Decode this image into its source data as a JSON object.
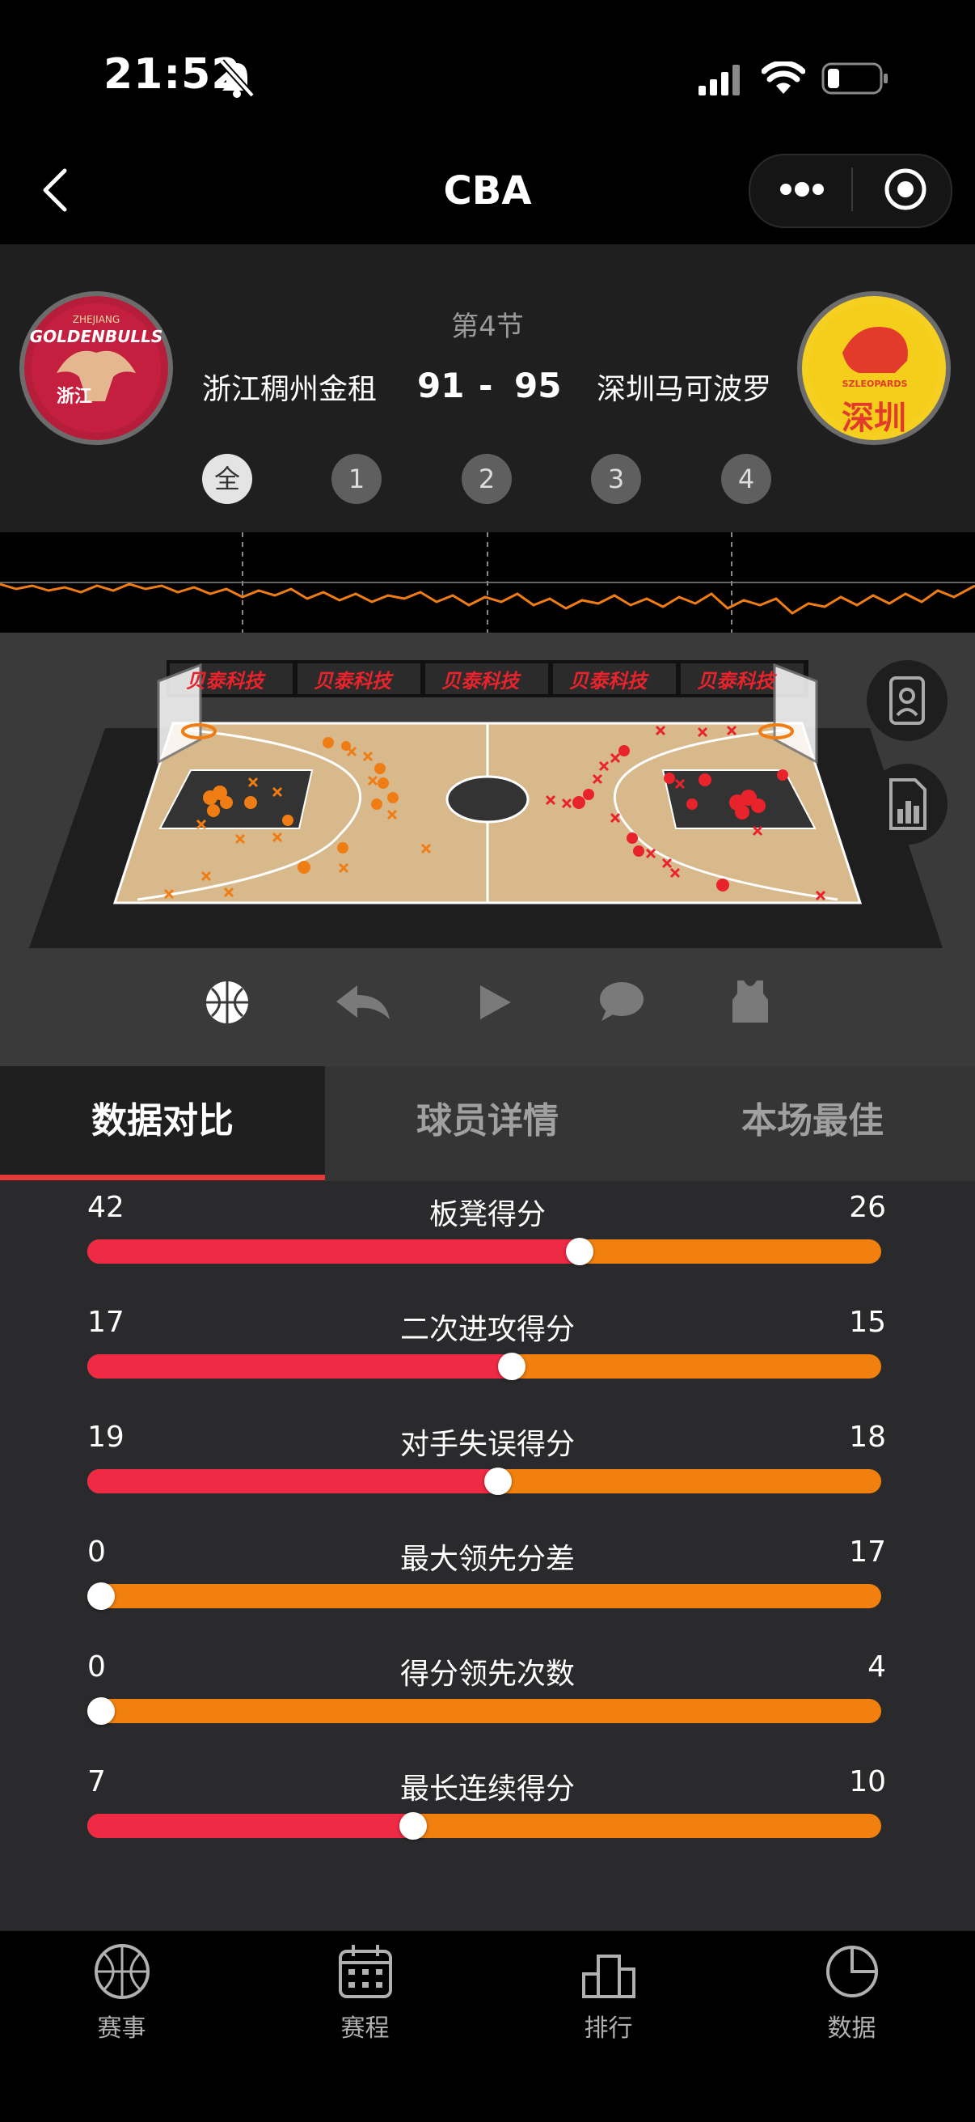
{
  "status": {
    "time": "21:52"
  },
  "nav": {
    "title": "CBA"
  },
  "match": {
    "period": "第4节",
    "home": {
      "name": "浙江稠州金租",
      "score": "91",
      "logo_text_top": "GOLDENBULLS",
      "logo_text_sub": "浙江",
      "logo_text_tiny": "ZHEJIANG"
    },
    "away": {
      "name": "深圳马可波罗",
      "score": "95",
      "logo_text_top": "SZLEOPARDS",
      "logo_text_sub": "深圳"
    },
    "dash": "-",
    "quarters": [
      "全",
      "1",
      "2",
      "3",
      "4"
    ],
    "active_quarter": 0
  },
  "court": {
    "banner": [
      "贝泰科技",
      "贝泰科技",
      "贝泰科技",
      "贝泰科技",
      "贝泰科技"
    ]
  },
  "tabs": [
    "数据对比",
    "球员详情",
    "本场最佳"
  ],
  "active_tab": 0,
  "stats": [
    {
      "label": "板凳得分",
      "home": "42",
      "away": "26",
      "home_share": 0.62
    },
    {
      "label": "二次进攻得分",
      "home": "17",
      "away": "15",
      "home_share": 0.535
    },
    {
      "label": "对手失误得分",
      "home": "19",
      "away": "18",
      "home_share": 0.517
    },
    {
      "label": "最大领先分差",
      "home": "0",
      "away": "17",
      "home_share": 0.0
    },
    {
      "label": "得分领先次数",
      "home": "0",
      "away": "4",
      "home_share": 0.0
    },
    {
      "label": "最长连续得分",
      "home": "7",
      "away": "10",
      "home_share": 0.41
    }
  ],
  "bottom_nav": [
    {
      "label": "赛事",
      "icon": "basketball-icon"
    },
    {
      "label": "赛程",
      "icon": "calendar-icon"
    },
    {
      "label": "排行",
      "icon": "podium-icon"
    },
    {
      "label": "数据",
      "icon": "pie-chart-icon"
    }
  ],
  "colors": {
    "home": "#ee2a44",
    "away": "#f1800f",
    "tab_indicator": "#e53a3a"
  }
}
